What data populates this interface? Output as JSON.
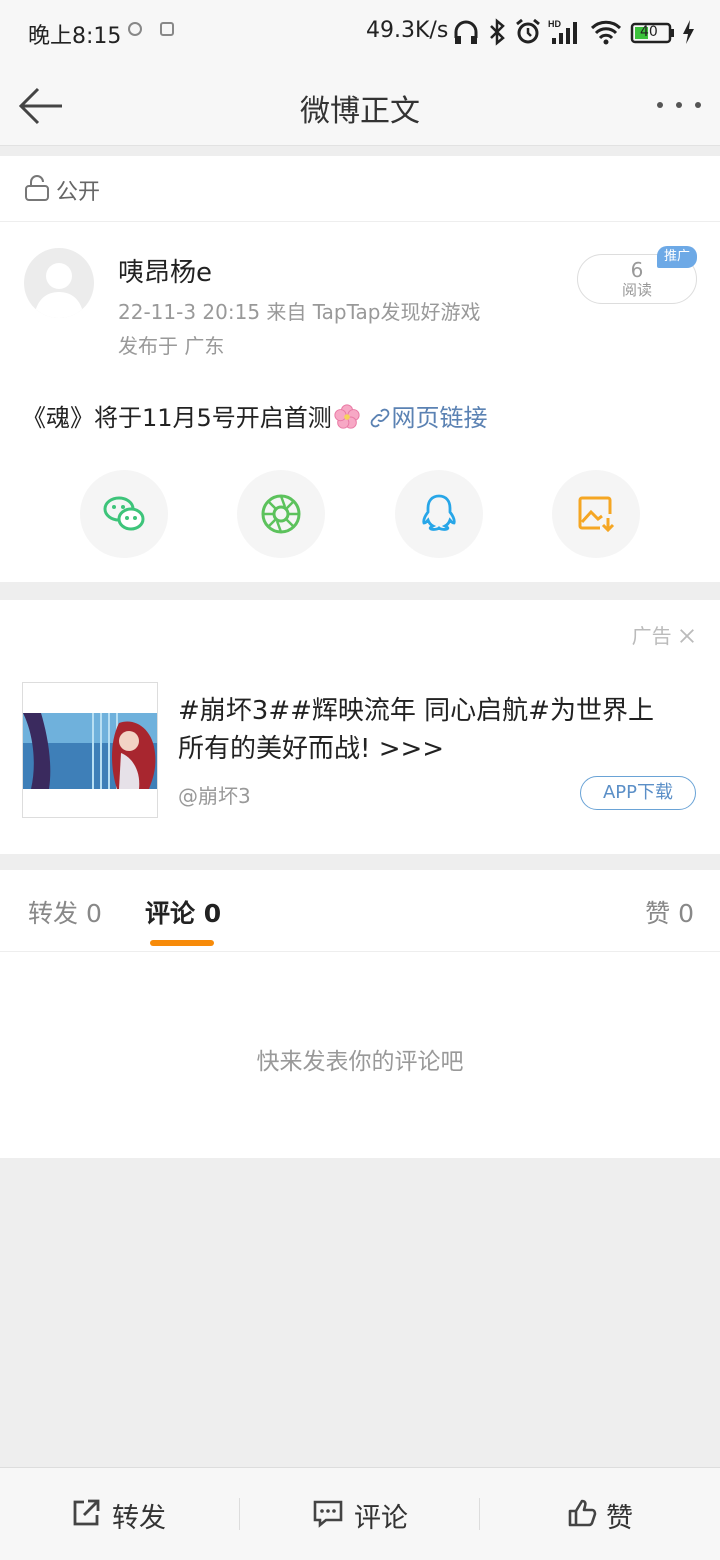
{
  "status_bar": {
    "time": "晚上8:15",
    "net_speed": "49.3K/s",
    "battery": "40"
  },
  "nav": {
    "title": "微博正文"
  },
  "visibility": {
    "label": "公开"
  },
  "post": {
    "username": "咦昂杨e",
    "meta": "22-11-3 20:15  来自 TapTap发现好游戏",
    "location": "发布于 广东",
    "reads": {
      "count": "6",
      "label": "阅读",
      "promo": "推广"
    },
    "text": "《魂》将于11月5号开启首测",
    "link_label": "网页链接",
    "share_icons": [
      "wechat-icon",
      "moments-icon",
      "qq-icon",
      "save-image-icon"
    ]
  },
  "ad": {
    "tag": "广告",
    "headline": "#崩坏3##辉映流年 同心启航#为世界上所有的美好而战! >>>",
    "author": "@崩坏3",
    "download_label": "APP下载"
  },
  "tabs": [
    {
      "label": "转发 0"
    },
    {
      "label": "评论 0",
      "active": true
    },
    {
      "label": "赞 0"
    }
  ],
  "comments": {
    "empty_text": "快来发表你的评论吧"
  },
  "bottom_bar": {
    "repost": "转发",
    "comment": "评论",
    "like": "赞"
  }
}
